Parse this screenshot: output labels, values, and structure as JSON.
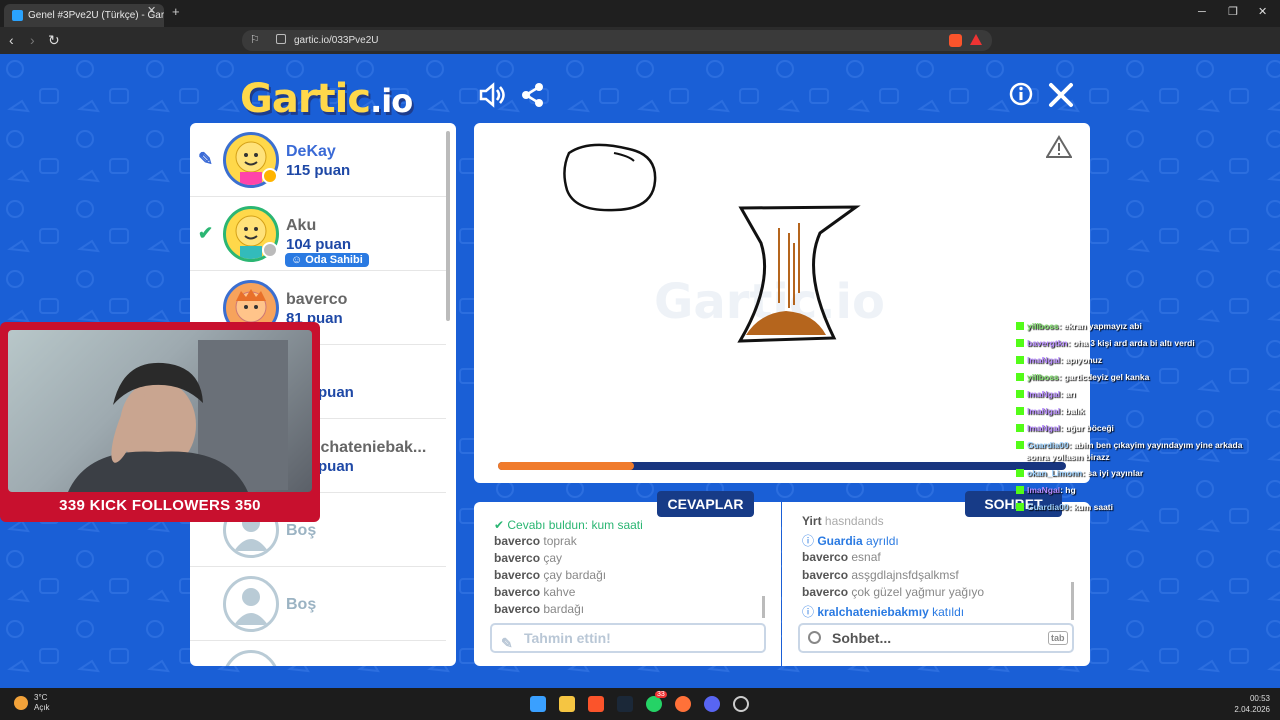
{
  "browser": {
    "tab_title": "Genel #3Pve2U (Türkçe) - Gartic",
    "url": "gartic.io/033Pve2U"
  },
  "game": {
    "logo": "Gartic",
    "logo_io": ".io",
    "players": [
      {
        "name": "DeKay",
        "score": "115 puan",
        "status": "drawing"
      },
      {
        "name": "Aku",
        "score": "104 puan",
        "status": "guessed",
        "badge": "Oda Sahibi"
      },
      {
        "name": "baverco",
        "score": "81 puan"
      },
      {
        "name": "",
        "score": "puan"
      },
      {
        "name": "lchateniebak...",
        "score": "puan"
      },
      {
        "name": "Boş"
      },
      {
        "name": "Boş"
      }
    ],
    "timer_progress": 0.24,
    "answers_tab": "CEVAPLAR",
    "chat_tab": "SOHBET",
    "answers": [
      {
        "user": "",
        "text": "Cevabı buldun: kum saati",
        "type": "correct"
      },
      {
        "user": "baverco",
        "text": "toprak"
      },
      {
        "user": "baverco",
        "text": "çay"
      },
      {
        "user": "baverco",
        "text": "çay bardağı"
      },
      {
        "user": "baverco",
        "text": "kahve"
      },
      {
        "user": "baverco",
        "text": "bardağı"
      }
    ],
    "guess_placeholder": "Tahmin ettin!",
    "chat": [
      {
        "user": "Yirt",
        "text": "hasndands"
      },
      {
        "user": "Guardia",
        "text": "ayrıldı",
        "type": "info"
      },
      {
        "user": "baverco",
        "text": "esnaf"
      },
      {
        "user": "baverco",
        "text": "asşgdlajnsfdşalkmsf"
      },
      {
        "user": "baverco",
        "text": "çok güzel yağmur yağıyo"
      },
      {
        "user": "kralchateniebakmıy",
        "text": "katıldı",
        "type": "info"
      }
    ],
    "chat_placeholder": "Sohbet...",
    "tab_key": "tab"
  },
  "stream": {
    "followers_label": "339 KICK FOLLOWERS 350",
    "chat": [
      {
        "user": "yillboss",
        "text": ": ekran yapmayız abi"
      },
      {
        "user": "bavergtkn",
        "text": ": oha 3 kişi ard arda bi altı verdi"
      },
      {
        "user": "ImaNgal",
        "text": ": apıyonuz"
      },
      {
        "user": "yillboss",
        "text": ": garticdeyiz gel kanka"
      },
      {
        "user": "ImaNgal",
        "text": ": arı"
      },
      {
        "user": "ImaNgal",
        "text": ": balık"
      },
      {
        "user": "ImaNgal",
        "text": ": uğur böceği"
      },
      {
        "user": "Guardia00",
        "text": ": abim ben çıkayim yayındayım yine arkada"
      },
      {
        "user": "",
        "text": "sonra yollasın birazz"
      },
      {
        "user": "okan_Limonn",
        "text": ": sa iyi yayınlar"
      },
      {
        "user": "ImaNgal",
        "text": ": hg"
      },
      {
        "user": "Guardia00",
        "text": ": kum saati"
      }
    ]
  },
  "taskbar": {
    "temp": "3°C",
    "weather": "Açık",
    "time": "00:53",
    "date": "2.04.2026",
    "notif": "33"
  },
  "colors": {
    "accent": "#1a5fd6",
    "dark": "#173b87",
    "timer": "#f07b2c",
    "kick": "#53fc18"
  }
}
